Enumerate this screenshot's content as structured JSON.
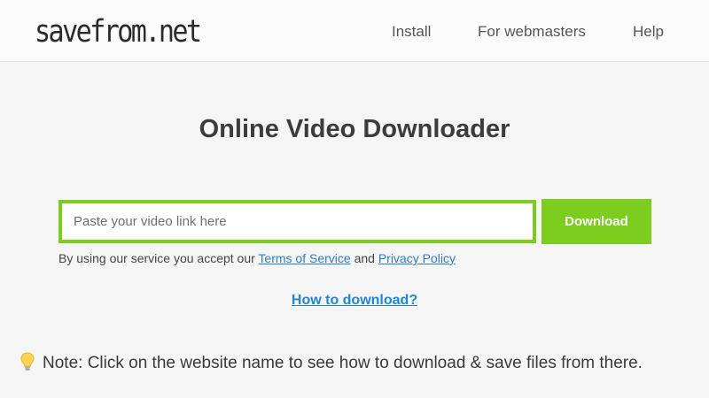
{
  "header": {
    "logo_text": "savefrom.net",
    "nav": [
      {
        "label": "Install"
      },
      {
        "label": "For webmasters"
      },
      {
        "label": "Help"
      }
    ]
  },
  "main": {
    "title": "Online Video Downloader",
    "url_input": {
      "value": "",
      "placeholder": "Paste your video link here"
    },
    "download_label": "Download",
    "terms": {
      "prefix": "By using our service you accept our",
      "tos_link": "Terms of Service",
      "joiner": "and",
      "privacy_link": "Privacy Policy"
    },
    "howto_link": "How to download?",
    "note": {
      "icon": "lightbulb-icon",
      "text": "Note: Click on the website name to see how to download & save files from there."
    }
  },
  "colors": {
    "accent_green": "#7ccd1e",
    "link_blue": "#2a7fc9",
    "title_text": "#3c3c3c",
    "background": "#f5f5f5"
  }
}
